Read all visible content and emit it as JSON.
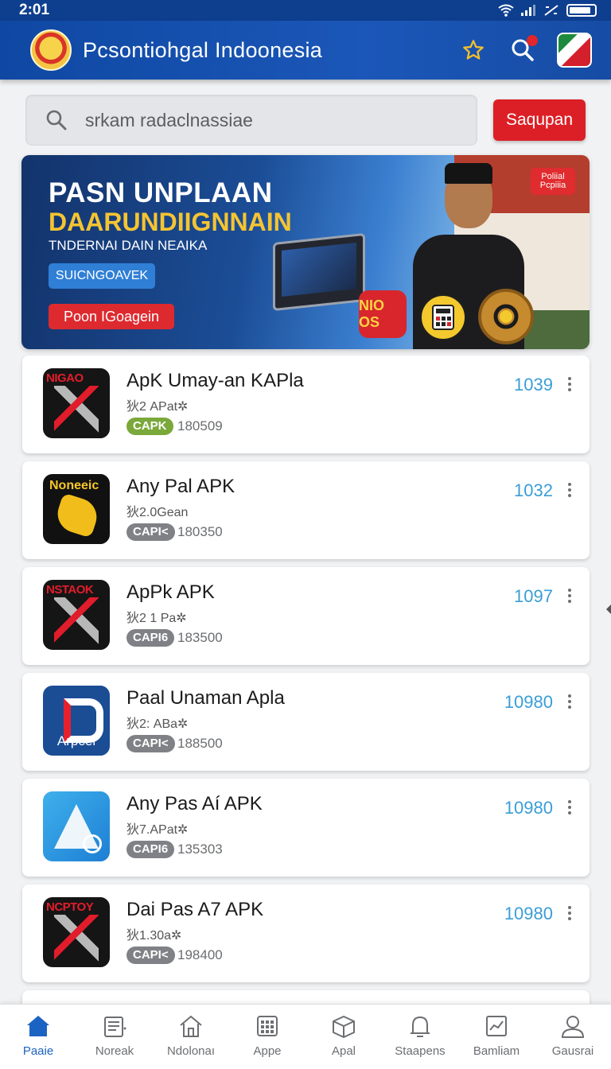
{
  "status_bar": {
    "time": "2:01"
  },
  "header": {
    "title": "Pcsontiohgal Indoonesia"
  },
  "search": {
    "placeholder": "srkam radaclnassiae",
    "button_label": "Saqupan"
  },
  "banner": {
    "title": "PASN UNPLAAN",
    "subtitle": "DAARUNDIIGNNAIN",
    "tagline": "TNDERNAI DAIN NEAIKA",
    "pill_label": "SUICNGOAVEK",
    "cta_label": "Poon IGoagein",
    "badge_text": "Poliial Pcpiiia",
    "coin_text": "NIO OS"
  },
  "apps": [
    {
      "icon_text": "NIGAO",
      "icon_style": "dark",
      "name": "ApK Umay-an KAPla",
      "meta": "狄2 APat✲",
      "tag": "CAPK",
      "tag_style": "green",
      "size": "180509",
      "rating": "1039"
    },
    {
      "icon_text": "Noneeic",
      "icon_style": "gold",
      "name": "Any Pal APK",
      "meta": "狄2.0Gean",
      "tag": "CAPI<",
      "tag_style": "gray",
      "size": "180350",
      "rating": "1032"
    },
    {
      "icon_text": "NSTAOK",
      "icon_style": "dark",
      "name": "ApPk APK",
      "meta": "狄2 1 Pa✲",
      "tag": "CAPI6",
      "tag_style": "gray",
      "size": "183500",
      "rating": "1097"
    },
    {
      "icon_text": "Arpcei",
      "icon_style": "blue",
      "name": "Paal Unaman Apla",
      "meta": "狄2: ABa✲",
      "tag": "CAPI<",
      "tag_style": "gray",
      "size": "188500",
      "rating": "10980"
    },
    {
      "icon_text": "",
      "icon_style": "sky",
      "name": "Any Pas Aí APK",
      "meta": "狄7.APat✲",
      "tag": "CAPI6",
      "tag_style": "gray",
      "size": "135303",
      "rating": "10980"
    },
    {
      "icon_text": "NCPTOY",
      "icon_style": "dark",
      "name": "Dai Pas A7 APK",
      "meta": "狄1.30a✲",
      "tag": "CAPI<",
      "tag_style": "gray",
      "size": "198400",
      "rating": "10980"
    }
  ],
  "nav": [
    {
      "label": "Paaie",
      "icon": "home-icon"
    },
    {
      "label": "Noreak",
      "icon": "list-icon"
    },
    {
      "label": "Ndolonaı",
      "icon": "house-outline-icon"
    },
    {
      "label": "Appe",
      "icon": "grid-icon"
    },
    {
      "label": "Apal",
      "icon": "box-icon"
    },
    {
      "label": "Staapens",
      "icon": "bell-icon"
    },
    {
      "label": "Bamliam",
      "icon": "chart-icon"
    },
    {
      "label": "Gausrai",
      "icon": "person-icon"
    }
  ],
  "colors": {
    "primary": "#0f48a3",
    "accent_red": "#dc1f26",
    "rating_blue": "#3a9ed6",
    "active_nav": "#1b63c2"
  }
}
